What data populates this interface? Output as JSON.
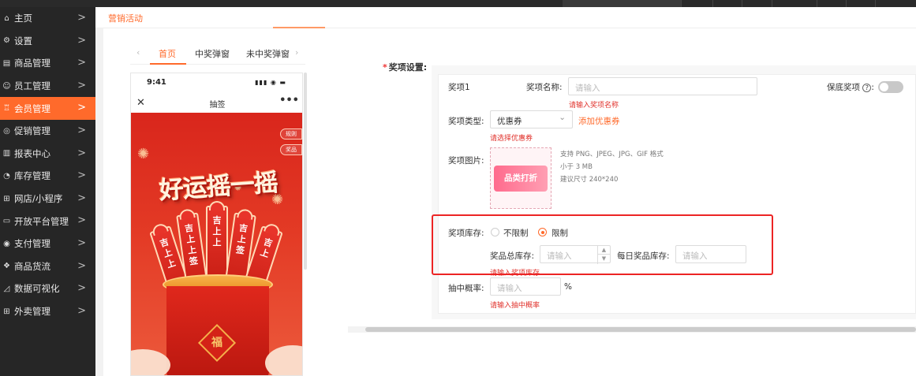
{
  "sidebar": {
    "items": [
      {
        "label": "主页",
        "icon": "home-icon",
        "glyph": "⌂"
      },
      {
        "label": "设置",
        "icon": "gear-icon",
        "glyph": "⚙"
      },
      {
        "label": "商品管理",
        "icon": "product-icon",
        "glyph": "▤"
      },
      {
        "label": "员工管理",
        "icon": "staff-icon",
        "glyph": "☺"
      },
      {
        "label": "会员管理",
        "icon": "member-icon",
        "glyph": "♖",
        "active": true
      },
      {
        "label": "促销管理",
        "icon": "promotion-icon",
        "glyph": "◎"
      },
      {
        "label": "报表中心",
        "icon": "report-icon",
        "glyph": "▥"
      },
      {
        "label": "库存管理",
        "icon": "inventory-icon",
        "glyph": "◔"
      },
      {
        "label": "网店/小程序",
        "icon": "shop-icon",
        "glyph": "⊞"
      },
      {
        "label": "开放平台管理",
        "icon": "platform-icon",
        "glyph": "▭"
      },
      {
        "label": "支付管理",
        "icon": "payment-icon",
        "glyph": "◉"
      },
      {
        "label": "商品货流",
        "icon": "logistics-icon",
        "glyph": "❖"
      },
      {
        "label": "数据可视化",
        "icon": "chart-icon",
        "glyph": "◿"
      },
      {
        "label": "外卖管理",
        "icon": "takeout-icon",
        "glyph": "⊞"
      }
    ],
    "chevron": ">"
  },
  "breadcrumb": {
    "current": "营销活动"
  },
  "phone_tabs": {
    "prev": "‹",
    "next": "›",
    "tabs": [
      "首页",
      "中奖弹窗",
      "未中奖弹窗"
    ]
  },
  "phone": {
    "time": "9:41",
    "status_icons": "▮▮▮ ◉ ▬",
    "close": "✕",
    "title": "抽签",
    "more": "•••",
    "side_tags": [
      "规则",
      "奖品"
    ],
    "poster_title": "好运摇一摇",
    "sticks": [
      [
        "吉",
        "上",
        "上"
      ],
      [
        "吉",
        "上",
        "上",
        "签"
      ],
      [
        "吉",
        "上",
        "上"
      ],
      [
        "吉",
        "上",
        "签"
      ],
      [
        "吉",
        "上"
      ]
    ],
    "fu": "福"
  },
  "form": {
    "section_label": "奖项设置:",
    "required_mark": "*",
    "prize_index": "奖项1",
    "name_label": "奖项名称:",
    "name_placeholder": "请输入",
    "name_error": "请输入奖项名称",
    "insure_label": "保底奖项",
    "insure_help": "?",
    "insure_colon": ":",
    "insure_on": false,
    "type_label": "奖项类型:",
    "type_value": "优惠券",
    "type_arrow": "⌄",
    "add_coupon": "添加优惠券",
    "type_error": "请选择优惠券",
    "image_label": "奖项图片:",
    "image_coupon_text": "品类打折",
    "image_hints": [
      "支持 PNG、JPEG、JPG、GIF 格式",
      "小于 3 MB",
      "建议尺寸 240*240"
    ],
    "stock_label": "奖项库存:",
    "stock_options": [
      {
        "label": "不限制",
        "checked": false
      },
      {
        "label": "限制",
        "checked": true
      }
    ],
    "total_stock_label": "奖品总库存:",
    "total_stock_placeholder": "请输入",
    "step_up": "▲",
    "step_down": "▼",
    "daily_stock_label": "每日奖品库存:",
    "daily_stock_placeholder": "请输入",
    "stock_error": "请输入奖项库存",
    "rate_label": "抽中概率:",
    "rate_placeholder": "请输入",
    "rate_unit": "%",
    "rate_error": "请输入抽中概率"
  },
  "colors": {
    "accent": "#ff6a2b",
    "sidebar_bg": "#262626",
    "error": "#e0302a",
    "highlight_box": "#ec2424"
  }
}
